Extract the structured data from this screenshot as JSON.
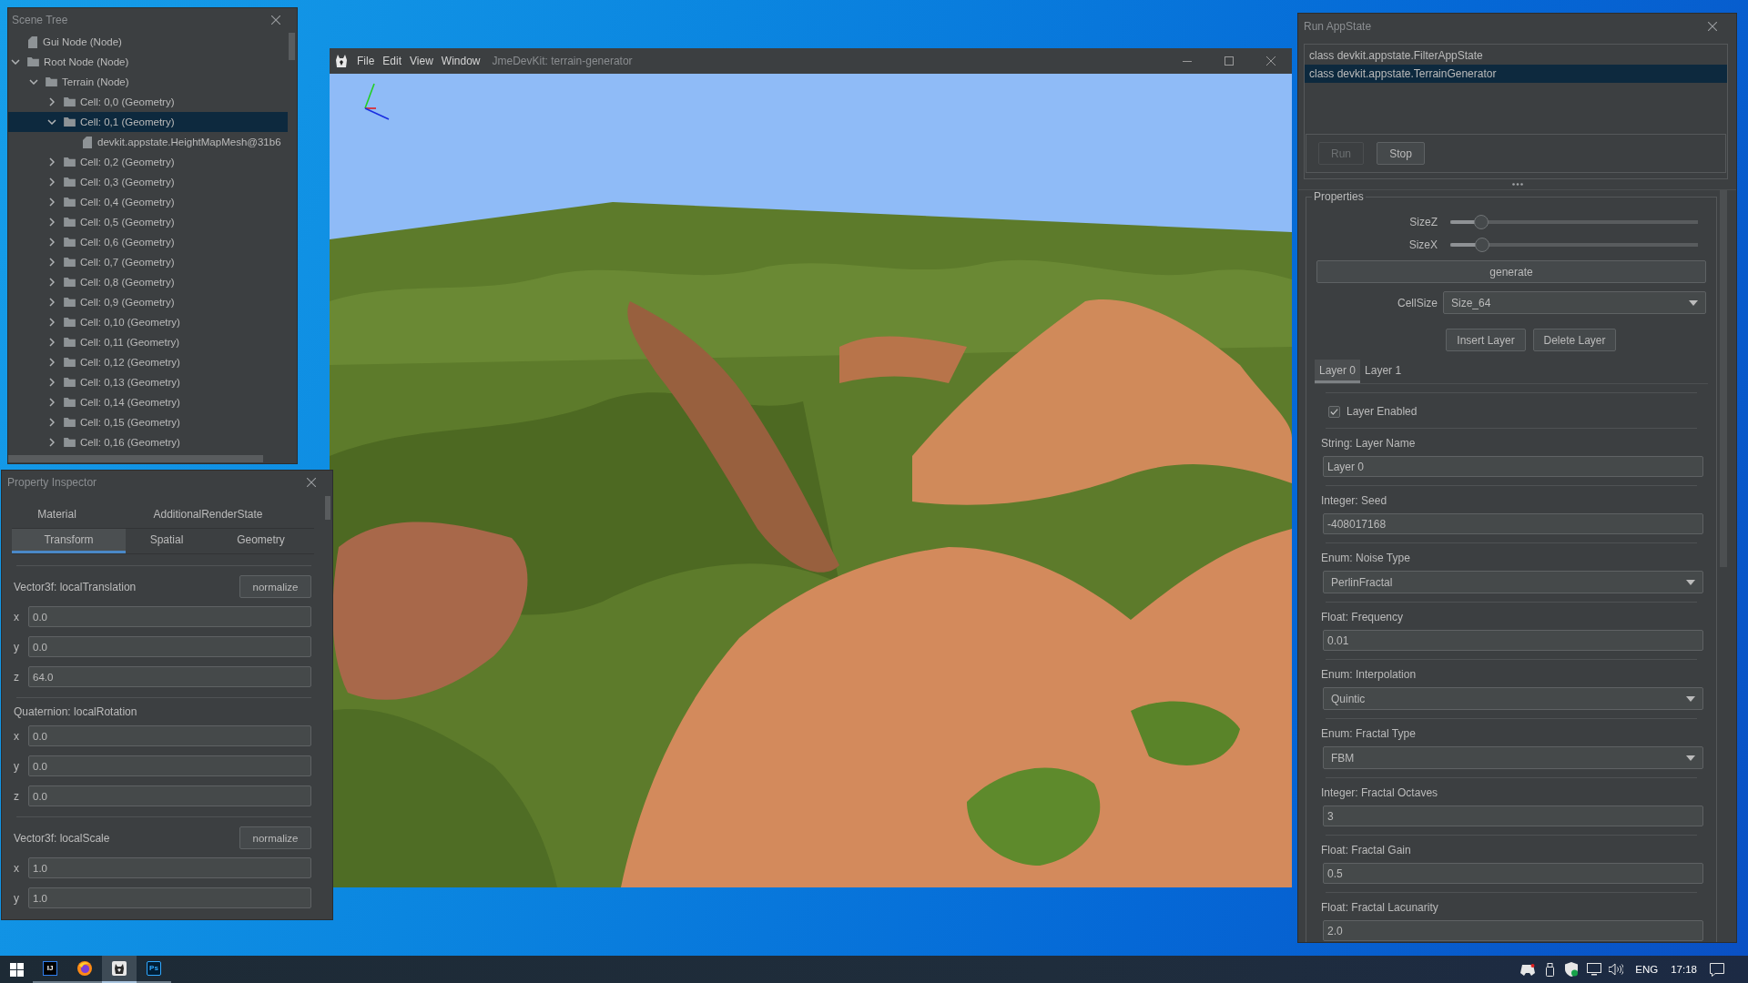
{
  "viewer_window": {
    "menu": [
      "File",
      "Edit",
      "View",
      "Window"
    ],
    "title": "JmeDevKit: terrain-generator"
  },
  "scene_tree": {
    "title": "Scene Tree",
    "items": [
      {
        "label": "Gui Node (Node)",
        "kind": "file",
        "selected": false
      },
      {
        "label": "Root Node (Node)",
        "kind": "folder",
        "expanded": true,
        "selected": false,
        "children": [
          {
            "label": "Terrain (Node)",
            "kind": "folder",
            "expanded": true,
            "selected": false,
            "children": [
              {
                "label": "Cell: 0,0 (Geometry)",
                "kind": "folder",
                "expanded": false,
                "selected": false
              },
              {
                "label": "Cell: 0,1 (Geometry)",
                "kind": "folder",
                "expanded": true,
                "selected": true,
                "children": [
                  {
                    "label": "devkit.appstate.HeightMapMesh@31b6",
                    "kind": "file",
                    "selected": false
                  }
                ]
              },
              {
                "label": "Cell: 0,2 (Geometry)",
                "kind": "folder",
                "expanded": false,
                "selected": false
              },
              {
                "label": "Cell: 0,3 (Geometry)",
                "kind": "folder",
                "expanded": false,
                "selected": false
              },
              {
                "label": "Cell: 0,4 (Geometry)",
                "kind": "folder",
                "expanded": false,
                "selected": false
              },
              {
                "label": "Cell: 0,5 (Geometry)",
                "kind": "folder",
                "expanded": false,
                "selected": false
              },
              {
                "label": "Cell: 0,6 (Geometry)",
                "kind": "folder",
                "expanded": false,
                "selected": false
              },
              {
                "label": "Cell: 0,7 (Geometry)",
                "kind": "folder",
                "expanded": false,
                "selected": false
              },
              {
                "label": "Cell: 0,8 (Geometry)",
                "kind": "folder",
                "expanded": false,
                "selected": false
              },
              {
                "label": "Cell: 0,9 (Geometry)",
                "kind": "folder",
                "expanded": false,
                "selected": false
              },
              {
                "label": "Cell: 0,10 (Geometry)",
                "kind": "folder",
                "expanded": false,
                "selected": false
              },
              {
                "label": "Cell: 0,11 (Geometry)",
                "kind": "folder",
                "expanded": false,
                "selected": false
              },
              {
                "label": "Cell: 0,12 (Geometry)",
                "kind": "folder",
                "expanded": false,
                "selected": false
              },
              {
                "label": "Cell: 0,13 (Geometry)",
                "kind": "folder",
                "expanded": false,
                "selected": false
              },
              {
                "label": "Cell: 0,14 (Geometry)",
                "kind": "folder",
                "expanded": false,
                "selected": false
              },
              {
                "label": "Cell: 0,15 (Geometry)",
                "kind": "folder",
                "expanded": false,
                "selected": false
              },
              {
                "label": "Cell: 0,16 (Geometry)",
                "kind": "folder",
                "expanded": false,
                "selected": false
              }
            ]
          }
        ]
      }
    ]
  },
  "property_inspector": {
    "title": "Property Inspector",
    "tab_rows": [
      [
        {
          "label": "Material",
          "selected": false
        },
        {
          "label": "AdditionalRenderState",
          "selected": false
        }
      ],
      [
        {
          "label": "Transform",
          "selected": true
        },
        {
          "label": "Spatial",
          "selected": false
        },
        {
          "label": "Geometry",
          "selected": false
        }
      ]
    ],
    "sections": [
      {
        "label": "Vector3f: localTranslation",
        "button": "normalize",
        "fields": [
          {
            "axis": "x",
            "value": "0.0"
          },
          {
            "axis": "y",
            "value": "0.0"
          },
          {
            "axis": "z",
            "value": "64.0"
          }
        ]
      },
      {
        "label": "Quaternion: localRotation",
        "fields": [
          {
            "axis": "x",
            "value": "0.0"
          },
          {
            "axis": "y",
            "value": "0.0"
          },
          {
            "axis": "z",
            "value": "0.0"
          }
        ]
      },
      {
        "label": "Vector3f: localScale",
        "button": "normalize",
        "fields": [
          {
            "axis": "x",
            "value": "1.0"
          },
          {
            "axis": "y",
            "value": "1.0"
          }
        ]
      }
    ]
  },
  "run_appstate": {
    "title": "Run AppState",
    "appstates": [
      {
        "label": "class devkit.appstate.FilterAppState",
        "selected": false
      },
      {
        "label": "class devkit.appstate.TerrainGenerator",
        "selected": true
      }
    ],
    "buttons": [
      {
        "label": "Run",
        "disabled": true
      },
      {
        "label": "Stop",
        "disabled": false
      }
    ],
    "properties": {
      "title": "Properties",
      "sliders": [
        {
          "label": "SizeZ",
          "level": 0.125
        },
        {
          "label": "SizeX",
          "level": 0.13
        }
      ],
      "generate_button": "generate",
      "cell_size": {
        "label": "CellSize",
        "value": "Size_64"
      },
      "layer_buttons": [
        "Insert Layer",
        "Delete Layer"
      ],
      "layer_tabs": [
        {
          "label": "Layer 0",
          "selected": true
        },
        {
          "label": "Layer 1",
          "selected": false
        }
      ],
      "layer_enabled": {
        "label": "Layer Enabled",
        "checked": true
      },
      "fields": [
        {
          "label": "String: Layer Name",
          "kind": "text",
          "value": "Layer 0"
        },
        {
          "label": "Integer: Seed",
          "kind": "text",
          "value": "-408017168"
        },
        {
          "label": "Enum: Noise Type",
          "kind": "select",
          "value": "PerlinFractal"
        },
        {
          "label": "Float: Frequency",
          "kind": "text",
          "value": "0.01"
        },
        {
          "label": "Enum: Interpolation",
          "kind": "select",
          "value": "Quintic"
        },
        {
          "label": "Enum: Fractal Type",
          "kind": "select",
          "value": "FBM"
        },
        {
          "label": "Integer: Fractal Octaves",
          "kind": "text",
          "value": "3"
        },
        {
          "label": "Float: Fractal Gain",
          "kind": "text",
          "value": "0.5"
        },
        {
          "label": "Float: Fractal Lacunarity",
          "kind": "text",
          "value": "2.0"
        }
      ]
    }
  },
  "taskbar": {
    "apps": [
      {
        "kind": "ide",
        "logo": "IJ",
        "selected": false
      },
      {
        "kind": "browser",
        "selected": false
      },
      {
        "kind": "engine",
        "selected": true
      },
      {
        "kind": "image-editor",
        "logo": "Ps",
        "selected": false
      }
    ],
    "language": "ENG",
    "time": "17:18"
  }
}
